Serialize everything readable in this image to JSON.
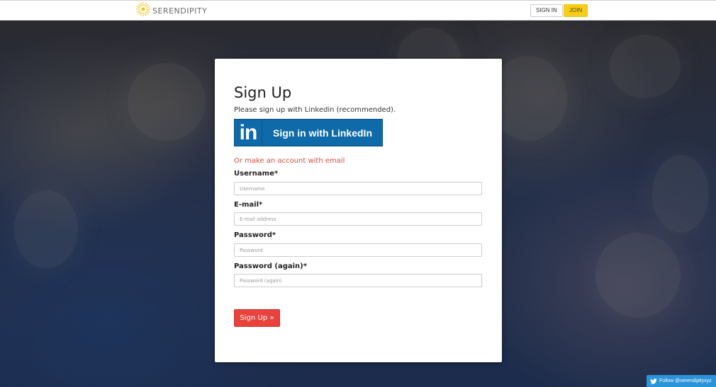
{
  "navbar": {
    "brand": "SERENDIPITY",
    "sign_in_label": "SIGN IN",
    "join_label": "JOIN"
  },
  "signup": {
    "title": "Sign Up",
    "subtitle": "Please sign up with Linkedin (recommended).",
    "linkedin_logo_text": "in",
    "linkedin_label": "Sign in with LinkedIn",
    "or_text": "Or make an account with email",
    "fields": [
      {
        "label": "Username*",
        "placeholder": "Username",
        "value": ""
      },
      {
        "label": "E-mail*",
        "placeholder": "E-mail address",
        "value": ""
      },
      {
        "label": "Password*",
        "placeholder": "Password",
        "value": ""
      },
      {
        "label": "Password (again)*",
        "placeholder": "Password (again)",
        "value": ""
      }
    ],
    "submit_label": "Sign Up »"
  },
  "twitter": {
    "follow_label": "Follow @serendipityxyz"
  },
  "colors": {
    "accent_red": "#e9423d",
    "linkedin_blue": "#0e6aa8",
    "join_yellow": "#f7cd1c",
    "or_text_red": "#d64b3a",
    "twitter_blue": "#2b93d8"
  },
  "icons": {
    "brand_logo": "sun-icon",
    "linkedin": "linkedin-icon",
    "twitter": "twitter-bird-icon"
  }
}
